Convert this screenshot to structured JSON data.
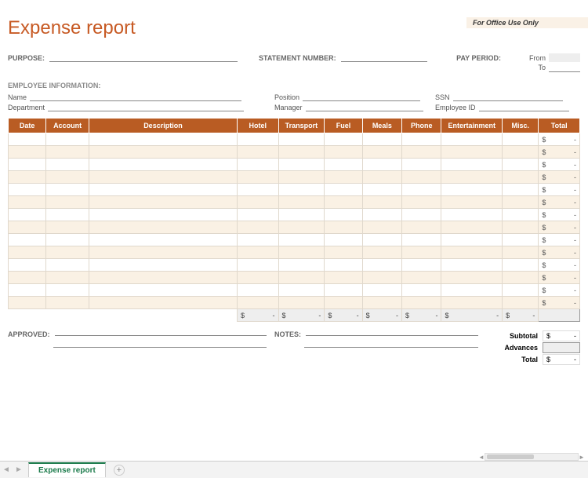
{
  "office_banner": "For Office Use Only",
  "title": "Expense report",
  "meta": {
    "purpose_label": "PURPOSE:",
    "statement_label": "STATEMENT NUMBER:",
    "pay_period_label": "PAY PERIOD:",
    "from_label": "From",
    "to_label": "To"
  },
  "employee": {
    "section": "EMPLOYEE INFORMATION:",
    "name_label": "Name",
    "position_label": "Position",
    "ssn_label": "SSN",
    "department_label": "Department",
    "manager_label": "Manager",
    "employee_id_label": "Employee ID"
  },
  "columns": [
    "Date",
    "Account",
    "Description",
    "Hotel",
    "Transport",
    "Fuel",
    "Meals",
    "Phone",
    "Entertainment",
    "Misc.",
    "Total"
  ],
  "row_count": 14,
  "currency": "$",
  "empty_value": "-",
  "summary": {
    "subtotal_label": "Subtotal",
    "advances_label": "Advances",
    "total_label": "Total"
  },
  "footer": {
    "approved_label": "APPROVED:",
    "notes_label": "NOTES:"
  },
  "tab_name": "Expense report",
  "chart_data": {
    "type": "table",
    "title": "Expense report",
    "columns": [
      "Date",
      "Account",
      "Description",
      "Hotel",
      "Transport",
      "Fuel",
      "Meals",
      "Phone",
      "Entertainment",
      "Misc.",
      "Total"
    ],
    "rows": [],
    "column_totals": {
      "Hotel": "-",
      "Transport": "-",
      "Fuel": "-",
      "Meals": "-",
      "Phone": "-",
      "Entertainment": "-",
      "Misc.": "-"
    },
    "subtotal": "-",
    "advances": "",
    "total": "-",
    "currency": "$"
  }
}
